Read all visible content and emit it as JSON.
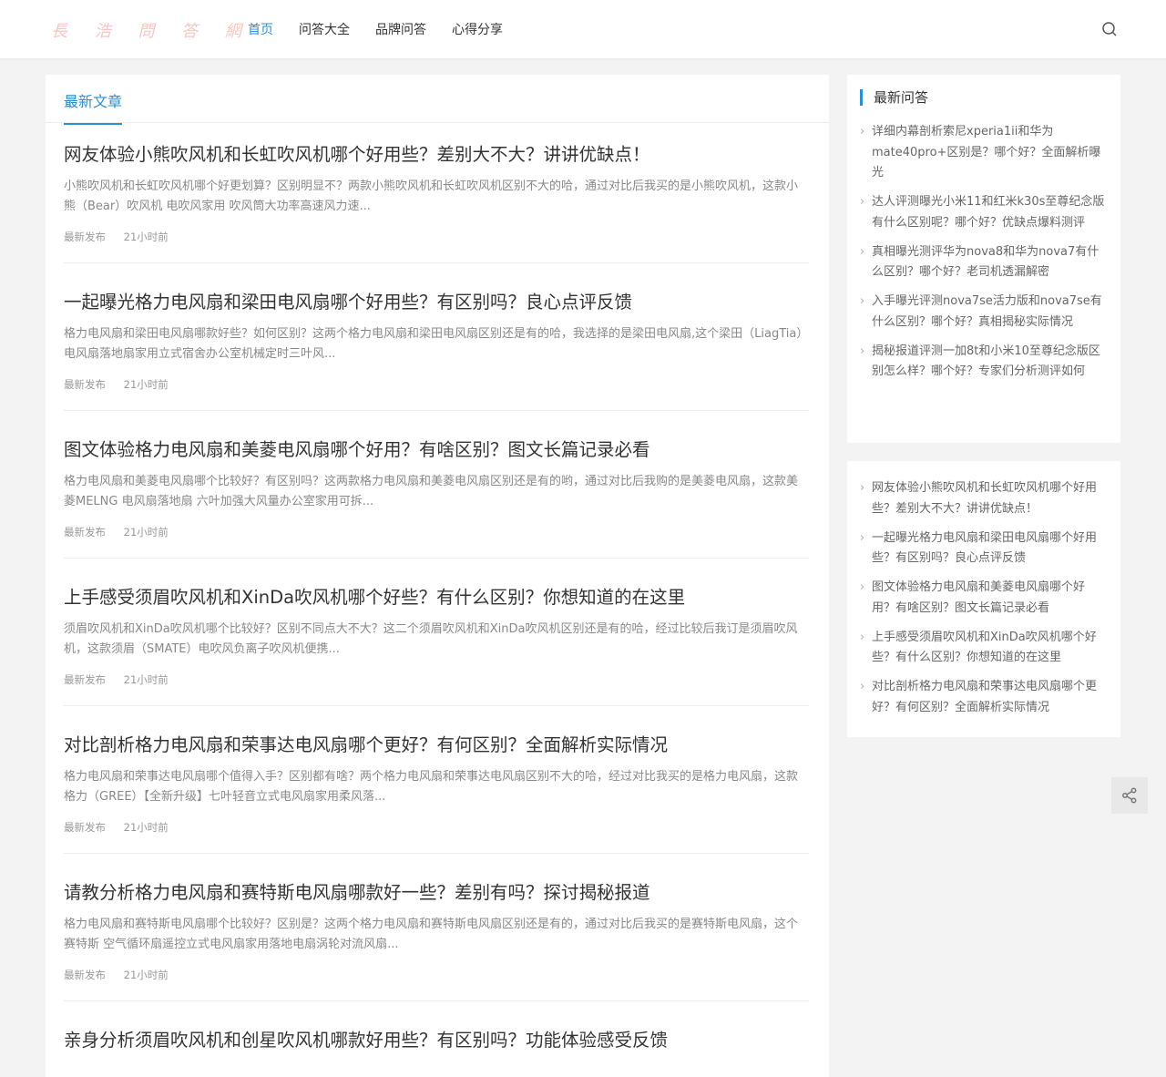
{
  "header": {
    "logo": "長 浩 問 答 網",
    "nav": [
      "首页",
      "问答大全",
      "品牌问答",
      "心得分享"
    ],
    "search_icon": "search-icon"
  },
  "main": {
    "tab": "最新文章",
    "articles": [
      {
        "title": "网友体验小熊吹风机和长虹吹风机哪个好用些？差别大不大？讲讲优缺点！",
        "excerpt": "小熊吹风机和长虹吹风机哪个好更划算？区别明显不？两款小熊吹风机和长虹吹风机区别不大的哈，通过对比后我买的是小熊吹风机，这款小熊（Bear）吹风机 电吹风家用 吹风筒大功率高速风力速...",
        "tag": "最新发布",
        "time": "21小时前"
      },
      {
        "title": "一起曝光格力电风扇和梁田电风扇哪个好用些？有区别吗？良心点评反馈",
        "excerpt": "格力电风扇和梁田电风扇哪款好些？如何区别？这两个格力电风扇和梁田电风扇区别还是有的哈，我选择的是梁田电风扇,这个梁田（LiagTia） 电风扇落地扇家用立式宿舍办公室机械定时三叶风...",
        "tag": "最新发布",
        "time": "21小时前"
      },
      {
        "title": "图文体验格力电风扇和美菱电风扇哪个好用？有啥区别？图文长篇记录必看",
        "excerpt": "格力电风扇和美菱电风扇哪个比较好？有区别吗？这两款格力电风扇和美菱电风扇区别还是有的哟，通过对比后我购的是美菱电风扇，这款美菱MELNG 电风扇落地扇 六叶加强大风量办公室家用可拆...",
        "tag": "最新发布",
        "time": "21小时前"
      },
      {
        "title": "上手感受须眉吹风机和XinDa吹风机哪个好些？有什么区别？你想知道的在这里",
        "excerpt": "须眉吹风机和XinDa吹风机哪个比较好？区别不同点大不大？这二个须眉吹风机和XinDa吹风机区别还是有的哈，经过比较后我订是须眉吹风机，这款须眉（SMATE）电吹风负离子吹风机便携...",
        "tag": "最新发布",
        "time": "21小时前"
      },
      {
        "title": "对比剖析格力电风扇和荣事达电风扇哪个更好？有何区别？全面解析实际情况",
        "excerpt": "格力电风扇和荣事达电风扇哪个值得入手？区别都有啥？两个格力电风扇和荣事达电风扇区别不大的哈，经过对比我买的是格力电风扇，这款格力（GREE）【全新升级】七叶轻音立式电风扇家用柔风落...",
        "tag": "最新发布",
        "time": "21小时前"
      },
      {
        "title": "请教分析格力电风扇和赛特斯电风扇哪款好一些？差别有吗？探讨揭秘报道",
        "excerpt": "格力电风扇和赛特斯电风扇哪个比较好？区别是？这两个格力电风扇和赛特斯电风扇区别还是有的，通过对比后我买的是赛特斯电风扇，这个赛特斯 空气循环扇遥控立式电风扇家用落地电扇涡轮对流风扇...",
        "tag": "最新发布",
        "time": "21小时前"
      },
      {
        "title": "亲身分析须眉吹风机和创星吹风机哪款好用些？有区别吗？功能体验感受反馈",
        "excerpt": "",
        "tag": "",
        "time": ""
      }
    ]
  },
  "sidebar": {
    "latest_title": "最新问答",
    "latest_items": [
      "详细内幕剖析索尼xperia1ii和华为mate40pro+区别是？哪个好？全面解析曝光",
      "达人评测曝光小米11和红米k30s至尊纪念版有什么区别呢？哪个好？优缺点爆料测评",
      "真相曝光测评华为nova8和华为nova7有什么区别？哪个好？老司机透漏解密",
      "入手曝光评测nova7se活力版和nova7se有什么区别？哪个好？真相揭秘实际情况",
      "揭秘报道评测一加8t和小米10至尊纪念版区别怎么样？哪个好？专家们分析测评如何"
    ],
    "recent_items": [
      "网友体验小熊吹风机和长虹吹风机哪个好用些？差别大不大？讲讲优缺点！",
      "一起曝光格力电风扇和梁田电风扇哪个好用些？有区别吗？良心点评反馈",
      "图文体验格力电风扇和美菱电风扇哪个好用？有啥区别？图文长篇记录必看",
      "上手感受须眉吹风机和XinDa吹风机哪个好些？有什么区别？你想知道的在这里",
      "对比剖析格力电风扇和荣事达电风扇哪个更好？有何区别？全面解析实际情况"
    ]
  },
  "share_icon": "share-icon"
}
